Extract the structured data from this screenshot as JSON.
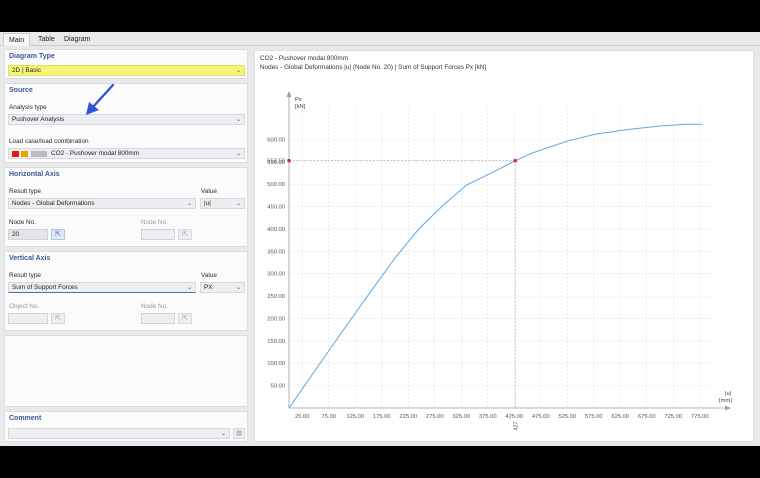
{
  "tabs": [
    "Main",
    "Table",
    "Diagram"
  ],
  "diagram_type": {
    "title": "Diagram Type",
    "value": "2D | Basic"
  },
  "source": {
    "title": "Source",
    "analysis_type_label": "Analysis type",
    "analysis_type_value": "Pushover Analysis",
    "load_case_label": "Load case/load combination",
    "load_case_value": "CO2 - Pushover modal 800mm"
  },
  "horizontal_axis": {
    "title": "Horizontal Axis",
    "result_type_label": "Result type",
    "result_type_value": "Nodes - Global Deformations",
    "value_label": "Value",
    "value_value": "|u|",
    "node_no_label": "Node No.",
    "node_no_value": "20",
    "node_no2_label": "Node No."
  },
  "vertical_axis": {
    "title": "Vertical Axis",
    "result_type_label": "Result type",
    "result_type_value": "Sum of Support Forces",
    "value_label": "Value",
    "value_value": "PX",
    "object_no_label": "Object No.",
    "node_no_label": "Node No."
  },
  "comment": {
    "title": "Comment"
  },
  "chart_header": {
    "line1": "CO2 - Pushover modal 800mm",
    "line2": "Nodes - Global Deformations |u| (Node No. 20) | Sum of Support Forces Px [kN]"
  },
  "colors": {
    "series": "#5aa7e8",
    "marker": "#c8322d",
    "accent": "#3a5a8f",
    "highlight": "#f4f47a"
  },
  "chart_data": {
    "type": "line",
    "ylabel": "Px\n[kN]",
    "xlabel": "|u|\n[mm]",
    "y_ticks": [
      "50.00",
      "100.00",
      "150.00",
      "200.00",
      "250.00",
      "300.00",
      "350.00",
      "400.00",
      "450.00",
      "500.00",
      "550.00",
      "600.00"
    ],
    "x_ticks": [
      "25.00",
      "75.00",
      "125.00",
      "175.00",
      "225.00",
      "275.00",
      "325.00",
      "375.00",
      "425.00",
      "475.00",
      "525.00",
      "575.00",
      "625.00",
      "675.00",
      "725.00",
      "775.00"
    ],
    "xlim": [
      0,
      800
    ],
    "ylim": [
      0,
      650
    ],
    "y_marker_label": "552.50",
    "x_marker_label": "427",
    "marker": {
      "x": 427,
      "y": 552.5
    },
    "series": [
      {
        "x": [
          0,
          50,
          100,
          150,
          200,
          245,
          290,
          335,
          380,
          427,
          460,
          490,
          530,
          580,
          640,
          700,
          750,
          780
        ],
        "y": [
          0,
          85,
          170,
          253,
          335,
          400,
          452,
          498,
          524,
          552.5,
          570,
          582,
          598,
          612,
          622,
          630,
          634,
          634
        ]
      }
    ]
  },
  "toolbar": [
    "axis-icon",
    "grid-icon",
    "print-icon",
    "zoom-icon",
    "zoom-in-icon",
    "zoom-out-icon",
    "zoom-fit-icon",
    "reset-icon",
    "export-icon",
    "settings-icon"
  ]
}
